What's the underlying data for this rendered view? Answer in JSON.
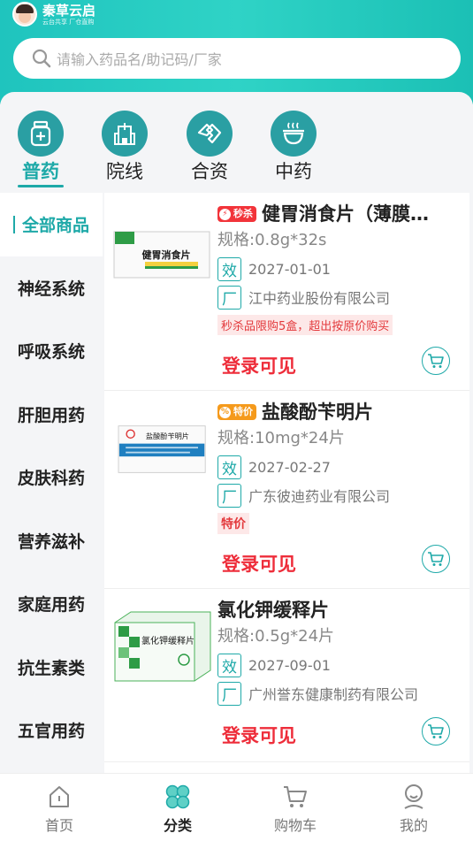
{
  "brand": {
    "name": "秦草云启",
    "tagline": "云台共享 厂仓直购"
  },
  "search": {
    "placeholder": "请输入药品名/助记码/厂家"
  },
  "categories": [
    {
      "label": "普药",
      "icon": "medicine-bottle-icon",
      "active": true
    },
    {
      "label": "院线",
      "icon": "hospital-icon",
      "active": false
    },
    {
      "label": "合资",
      "icon": "handshake-icon",
      "active": false
    },
    {
      "label": "中药",
      "icon": "herbal-tea-icon",
      "active": false
    }
  ],
  "sidebar": {
    "items": [
      "全部商品",
      "神经系统",
      "呼吸系统",
      "肝胆用药",
      "皮肤科药",
      "营养滋补",
      "家庭用药",
      "抗生素类",
      "五官用药"
    ],
    "active_index": 0
  },
  "products": [
    {
      "tag": "秒杀",
      "tag_type": "flash-sale",
      "name": "健胃消食片（薄膜衣）",
      "spec": "规格:0.8g*32s",
      "expiry_label": "效",
      "expiry": "2027-01-01",
      "maker_label": "厂",
      "maker": "江中药业股份有限公司",
      "promo": "秒杀品限购5盒，超出按原价购买",
      "price_text": "登录可见",
      "box_text": "健胃消食片"
    },
    {
      "tag": "特价",
      "tag_type": "special-price",
      "name": "盐酸酚苄明片",
      "spec": "规格:10mg*24片",
      "expiry_label": "效",
      "expiry": "2027-02-27",
      "maker_label": "厂",
      "maker": "广东彼迪药业有限公司",
      "promo": "特价",
      "price_text": "登录可见",
      "box_text": "盐酸酚苄明片"
    },
    {
      "tag": "",
      "tag_type": "",
      "name": "氯化钾缓释片",
      "spec": "规格:0.5g*24片",
      "expiry_label": "效",
      "expiry": "2027-09-01",
      "maker_label": "厂",
      "maker": "广州誉东健康制药有限公司",
      "promo": "",
      "price_text": "登录可见",
      "box_text": "氯化钾缓释片"
    }
  ],
  "tabbar": [
    {
      "label": "首页",
      "icon": "home-icon",
      "active": false
    },
    {
      "label": "分类",
      "icon": "category-icon",
      "active": true
    },
    {
      "label": "购物车",
      "icon": "cart-icon",
      "active": false
    },
    {
      "label": "我的",
      "icon": "profile-icon",
      "active": false
    }
  ],
  "colors": {
    "accent": "#1ea9a8",
    "header": "#2fd3c6",
    "price": "#ee2d3a",
    "flash_tag": "#f2343a",
    "special_tag": "#f59a1c"
  }
}
